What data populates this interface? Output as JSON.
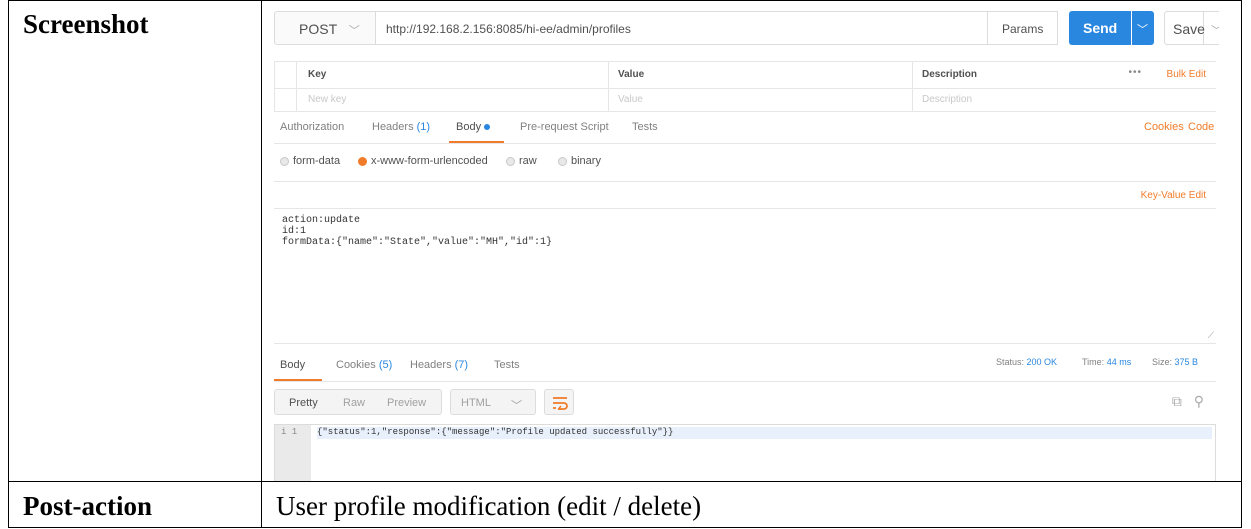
{
  "doc": {
    "row1_label": "Screenshot",
    "row2_label": "Post-action",
    "row2_value": "User profile modification (edit / delete)"
  },
  "request": {
    "method": "POST",
    "url": "http://192.168.2.156:8085/hi-ee/admin/profiles",
    "params_label": "Params",
    "send_label": "Send",
    "save_label": "Save"
  },
  "params_table": {
    "headers": [
      "Key",
      "Value",
      "Description"
    ],
    "placeholders": [
      "New key",
      "Value",
      "Description"
    ],
    "bulk_edit": "Bulk Edit",
    "more": "•••"
  },
  "req_tabs": {
    "authorization": "Authorization",
    "headers": "Headers",
    "headers_count": "(1)",
    "body": "Body",
    "prerequest": "Pre-request Script",
    "tests": "Tests",
    "cookies": "Cookies",
    "code": "Code"
  },
  "body_modes": {
    "form_data": "form-data",
    "urlencoded": "x-www-form-urlencoded",
    "raw": "raw",
    "binary": "binary",
    "selected": "x-www-form-urlencoded"
  },
  "kv_edit": "Key-Value Edit",
  "body_lines": [
    "action:update",
    "id:1",
    "formData:{\"name\":\"State\",\"value\":\"MH\",\"id\":1}"
  ],
  "response": {
    "tabs": {
      "body": "Body",
      "cookies": "Cookies",
      "cookies_count": "(5)",
      "headers": "Headers",
      "headers_count": "(7)",
      "tests": "Tests"
    },
    "status_label": "Status:",
    "status_value": "200 OK",
    "time_label": "Time:",
    "time_value": "44 ms",
    "size_label": "Size:",
    "size_value": "375 B",
    "view_pretty": "Pretty",
    "view_raw": "Raw",
    "view_preview": "Preview",
    "format": "HTML",
    "line_info": "i 1",
    "line_text": "{\"status\":1,\"response\":{\"message\":\"Profile updated successfully\"}}"
  },
  "colors": {
    "accent": "#2a87e0",
    "orange": "#f07c2b"
  }
}
